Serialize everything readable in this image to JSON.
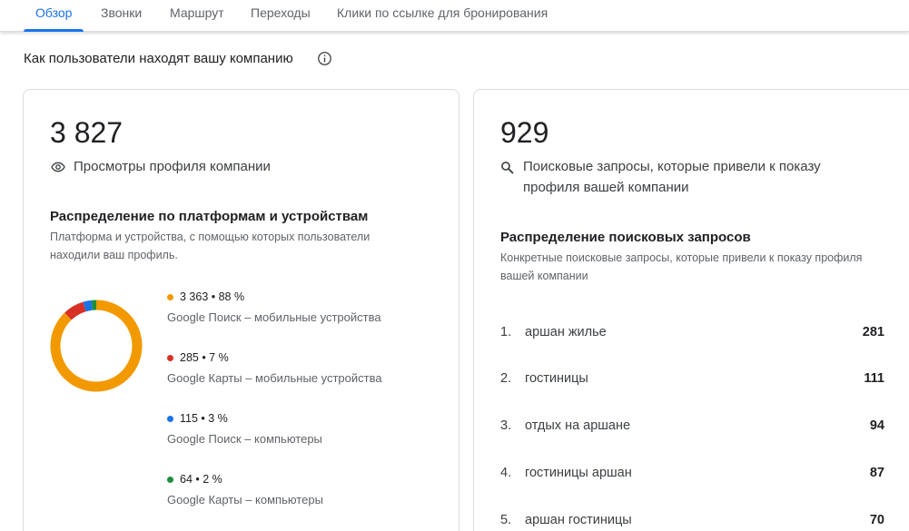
{
  "tabs": [
    {
      "label": "Обзор",
      "active": true
    },
    {
      "label": "Звонки",
      "active": false
    },
    {
      "label": "Маршрут",
      "active": false
    },
    {
      "label": "Переходы",
      "active": false
    },
    {
      "label": "Клики по ссылке для бронирования",
      "active": false
    }
  ],
  "section": {
    "title": "Как пользователи находят вашу компанию",
    "info_icon": "info-icon"
  },
  "views_card": {
    "total": "3 827",
    "icon": "eye-icon",
    "label": "Просмотры профиля компании",
    "breakdown_title": "Распределение по платформам и устройствам",
    "breakdown_desc": "Платформа и устройства, с помощью которых пользователи находили ваш профиль.",
    "legend": [
      {
        "value": "3 363 • 88 %",
        "label": "Google Поиск – мобильные устройства",
        "color": "#f29900",
        "count": 3363
      },
      {
        "value": "285 • 7 %",
        "label": "Google Карты – мобильные устройства",
        "color": "#d93025",
        "count": 285
      },
      {
        "value": "115 • 3 %",
        "label": "Google Поиск – компьютеры",
        "color": "#1a73e8",
        "count": 115
      },
      {
        "value": "64 • 2 %",
        "label": "Google Карты – компьютеры",
        "color": "#1e8e3e",
        "count": 64
      }
    ]
  },
  "search_card": {
    "total": "929",
    "icon": "search-icon",
    "label": "Поисковые запросы, которые привели к показу профиля вашей компании",
    "breakdown_title": "Распределение поисковых запросов",
    "breakdown_desc": "Конкретные поисковые запросы, которые привели к показу профиля вашей компании",
    "queries": [
      {
        "rank": "1.",
        "text": "аршан жилье",
        "count": "281"
      },
      {
        "rank": "2.",
        "text": "гостиницы",
        "count": "111"
      },
      {
        "rank": "3.",
        "text": "отдых на аршане",
        "count": "94"
      },
      {
        "rank": "4.",
        "text": "гостиницы аршан",
        "count": "87"
      },
      {
        "rank": "5.",
        "text": "аршан гостиницы",
        "count": "70"
      }
    ]
  },
  "colors": {
    "accent": "#1a73e8",
    "text_primary": "#202124",
    "text_secondary": "#5f6368"
  }
}
